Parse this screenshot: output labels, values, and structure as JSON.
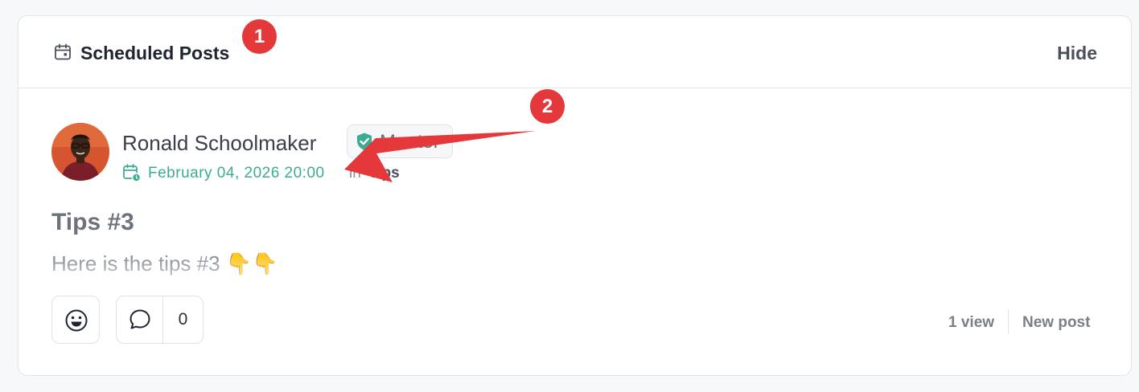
{
  "header": {
    "title": "Scheduled Posts",
    "hide_label": "Hide",
    "icon": "calendar-icon"
  },
  "annotations": [
    "1",
    "2"
  ],
  "post": {
    "author": {
      "name": "Ronald Schoolmaker",
      "badge": "Mentor",
      "badge_icon": "shield-check-icon"
    },
    "schedule": {
      "datetime": "February 04, 2026 20:00",
      "in_label": "in",
      "space": "Tips"
    },
    "title": "Tips #3",
    "body": "Here is the tips #3 👇👇"
  },
  "footer": {
    "comment_count": "0",
    "views": "1 view",
    "new_post_label": "New post"
  },
  "colors": {
    "accent_green": "#3bab93",
    "annotation_red": "#e5383b"
  }
}
